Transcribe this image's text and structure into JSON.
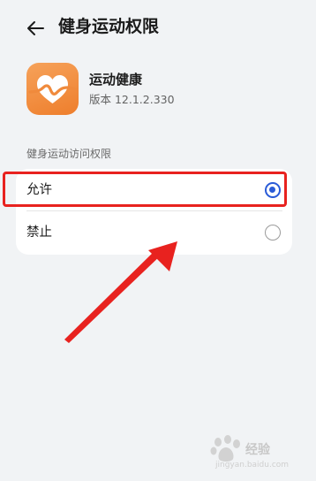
{
  "header": {
    "title": "健身运动权限",
    "back_icon": "back-arrow-icon"
  },
  "app": {
    "name": "运动健康",
    "version": "版本 12.1.2.330",
    "icon": "heart-pulse-icon",
    "icon_color": "#ef8433"
  },
  "permission": {
    "section_label": "健身运动访问权限",
    "options": [
      {
        "label": "允许",
        "selected": true
      },
      {
        "label": "禁止",
        "selected": false
      }
    ]
  },
  "colors": {
    "accent": "#2a5bd7",
    "annotation": "#e8221f"
  },
  "watermark": {
    "brand": "经验",
    "url": "jingyan.baidu.com",
    "icon": "baidu-paw-icon"
  }
}
